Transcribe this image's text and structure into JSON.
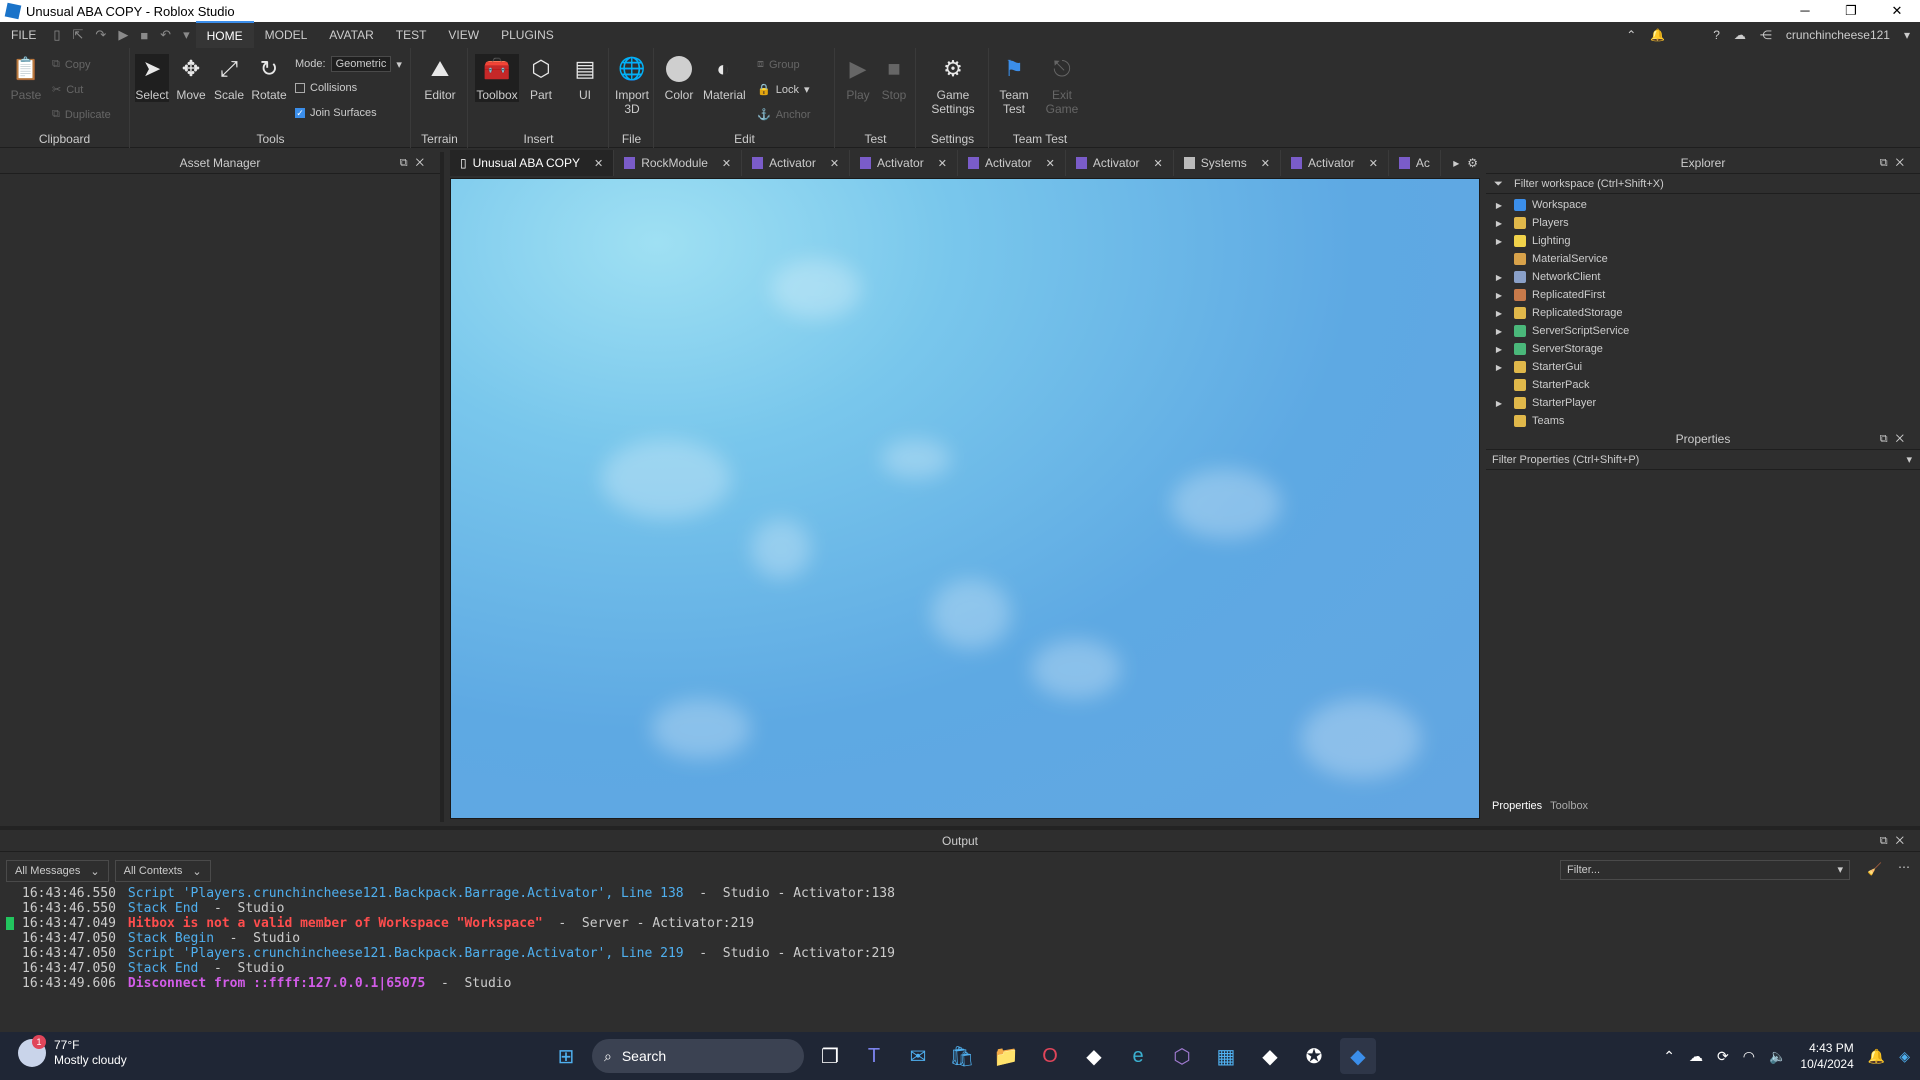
{
  "window": {
    "title": "Unusual ABA COPY - Roblox Studio",
    "minimize": "─",
    "restore": "❐",
    "close": "✕"
  },
  "menubar": {
    "menus": [
      "FILE",
      "HOME",
      "MODEL",
      "AVATAR",
      "TEST",
      "VIEW",
      "PLUGINS"
    ],
    "active": "HOME",
    "user": "crunchincheese121"
  },
  "ribbon": {
    "clipboard": {
      "label": "Clipboard",
      "paste": "Paste",
      "copy": "Copy",
      "cut": "Cut",
      "duplicate": "Duplicate"
    },
    "tools": {
      "label": "Tools",
      "select": "Select",
      "move": "Move",
      "scale": "Scale",
      "rotate": "Rotate",
      "mode_label": "Mode:",
      "mode_value": "Geometric",
      "collisions": "Collisions",
      "join_surfaces": "Join Surfaces",
      "collisions_checked": false,
      "join_checked": true
    },
    "terrain": {
      "label": "Terrain",
      "editor": "Editor"
    },
    "insert": {
      "label": "Insert",
      "toolbox": "Toolbox",
      "part": "Part",
      "ui": "UI"
    },
    "file": {
      "label": "File",
      "import3d": "Import 3D"
    },
    "edit": {
      "label": "Edit",
      "color": "Color",
      "material": "Material",
      "group": "Group",
      "lock": "Lock",
      "anchor": "Anchor"
    },
    "test": {
      "label": "Test",
      "play": "Play",
      "stop": "Stop"
    },
    "settings": {
      "label": "Settings",
      "game_settings": "Game Settings"
    },
    "teamtest": {
      "label": "Team Test",
      "team_test": "Team Test",
      "exit_game": "Exit Game"
    }
  },
  "asset_manager": {
    "title": "Asset Manager"
  },
  "tabs": [
    {
      "label": "Unusual ABA COPY",
      "active": true
    },
    {
      "label": "RockModule"
    },
    {
      "label": "Activator"
    },
    {
      "label": "Activator"
    },
    {
      "label": "Activator"
    },
    {
      "label": "Activator"
    },
    {
      "label": "Systems"
    },
    {
      "label": "Activator"
    },
    {
      "label": "Ac"
    }
  ],
  "explorer": {
    "title": "Explorer",
    "filter": "Filter workspace (Ctrl+Shift+X)",
    "items": [
      {
        "label": "Workspace",
        "color": "#3b8eea",
        "expand": true
      },
      {
        "label": "Players",
        "color": "#e0b84a",
        "expand": true
      },
      {
        "label": "Lighting",
        "color": "#f0d24a",
        "expand": true
      },
      {
        "label": "MaterialService",
        "color": "#d8a24a",
        "expand": false
      },
      {
        "label": "NetworkClient",
        "color": "#8aa0c8",
        "expand": true
      },
      {
        "label": "ReplicatedFirst",
        "color": "#c87a4a",
        "expand": true
      },
      {
        "label": "ReplicatedStorage",
        "color": "#e0b84a",
        "expand": true
      },
      {
        "label": "ServerScriptService",
        "color": "#4ab87a",
        "expand": true
      },
      {
        "label": "ServerStorage",
        "color": "#4ab87a",
        "expand": true
      },
      {
        "label": "StarterGui",
        "color": "#e0b84a",
        "expand": true
      },
      {
        "label": "StarterPack",
        "color": "#e0b84a",
        "expand": false
      },
      {
        "label": "StarterPlayer",
        "color": "#e0b84a",
        "expand": true
      },
      {
        "label": "Teams",
        "color": "#e0b84a",
        "expand": false
      }
    ]
  },
  "properties": {
    "title": "Properties",
    "filter": "Filter Properties (Ctrl+Shift+P)"
  },
  "bottom_tabs": [
    "Properties",
    "Toolbox"
  ],
  "output": {
    "title": "Output",
    "all_messages": "All Messages",
    "all_contexts": "All Contexts",
    "filter_placeholder": "Filter...",
    "lines": [
      {
        "ts": "16:43:46.550",
        "msg": "Script 'Players.crunchincheese121.Backpack.Barrage.Activator', Line 138",
        "tail": "  -  Studio - Activator:138",
        "kind": "blue"
      },
      {
        "ts": "16:43:46.550",
        "msg": "Stack End",
        "tail": "  -  Studio",
        "kind": "blue"
      },
      {
        "ts": "16:43:47.049",
        "msg": "Hitbox is not a valid member of Workspace \"Workspace\"",
        "tail": "  -  Server - Activator:219",
        "kind": "red"
      },
      {
        "ts": "16:43:47.050",
        "msg": "Stack Begin",
        "tail": "  -  Studio",
        "kind": "blue"
      },
      {
        "ts": "16:43:47.050",
        "msg": "Script 'Players.crunchincheese121.Backpack.Barrage.Activator', Line 219",
        "tail": "  -  Studio - Activator:219",
        "kind": "blue"
      },
      {
        "ts": "16:43:47.050",
        "msg": "Stack End",
        "tail": "  -  Studio",
        "kind": "blue"
      },
      {
        "ts": "16:43:49.606",
        "msg": "Disconnect from ::ffff:127.0.0.1|65075",
        "tail": "  -  Studio",
        "kind": "purple"
      }
    ]
  },
  "taskbar": {
    "weather_temp": "77°F",
    "weather_desc": "Mostly cloudy",
    "weather_badge": "1",
    "search": "Search",
    "time": "4:43 PM",
    "date": "10/4/2024"
  }
}
